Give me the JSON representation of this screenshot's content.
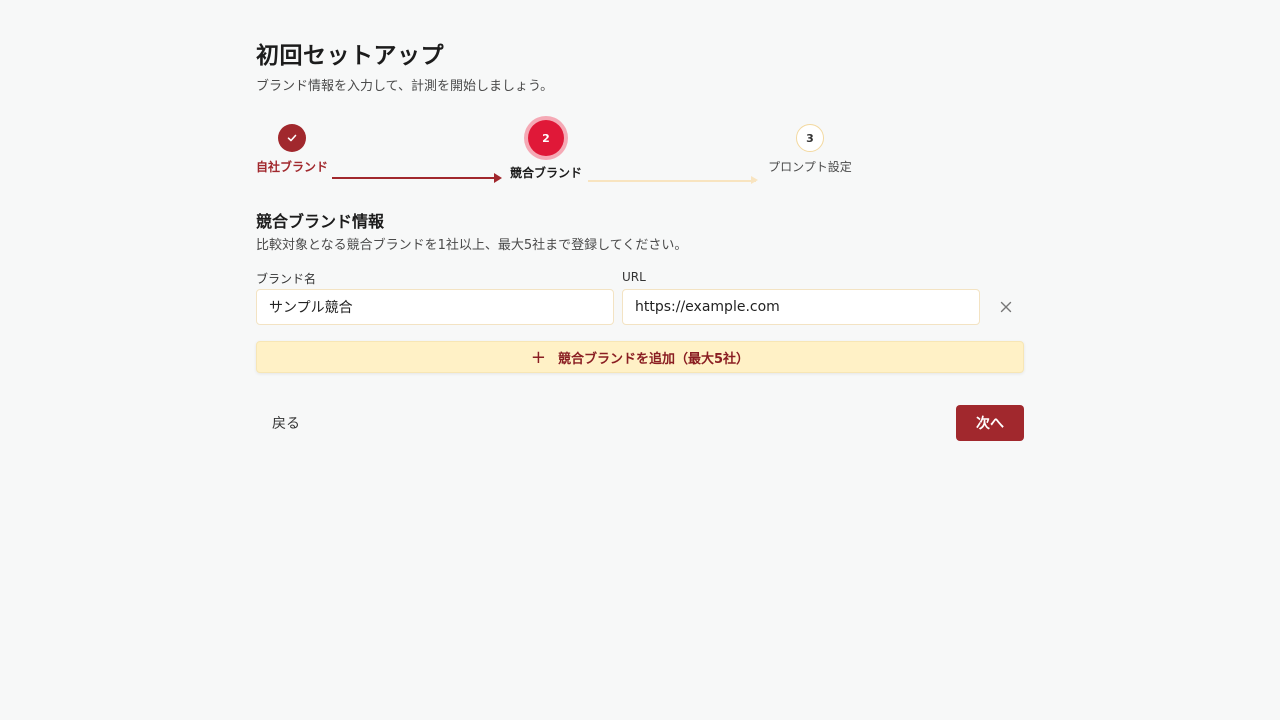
{
  "header": {
    "title": "初回セットアップ",
    "subtitle": "ブランド情報を入力して、計測を開始しましょう。"
  },
  "stepper": {
    "steps": [
      {
        "number": "",
        "label": "自社ブランド",
        "status": "completed",
        "icon": "check-icon"
      },
      {
        "number": "2",
        "label": "競合ブランド",
        "status": "active"
      },
      {
        "number": "3",
        "label": "プロンプト設定",
        "status": "upcoming"
      }
    ]
  },
  "section": {
    "title": "競合ブランド情報",
    "description": "比較対象となる競合ブランドを1社以上、最大5社まで登録してください。"
  },
  "form": {
    "name_label": "ブランド名",
    "url_label": "URL",
    "rows": [
      {
        "name": "サンプル競合",
        "url": "https://example.com"
      }
    ],
    "remove_icon": "close-icon",
    "add_label": "競合ブランドを追加（最大5社）",
    "add_icon": "plus-icon"
  },
  "actions": {
    "back_label": "戻る",
    "next_label": "次へ"
  },
  "colors": {
    "primary": "#a1282d",
    "active": "#e01838",
    "add_bg": "#fff1c6"
  }
}
